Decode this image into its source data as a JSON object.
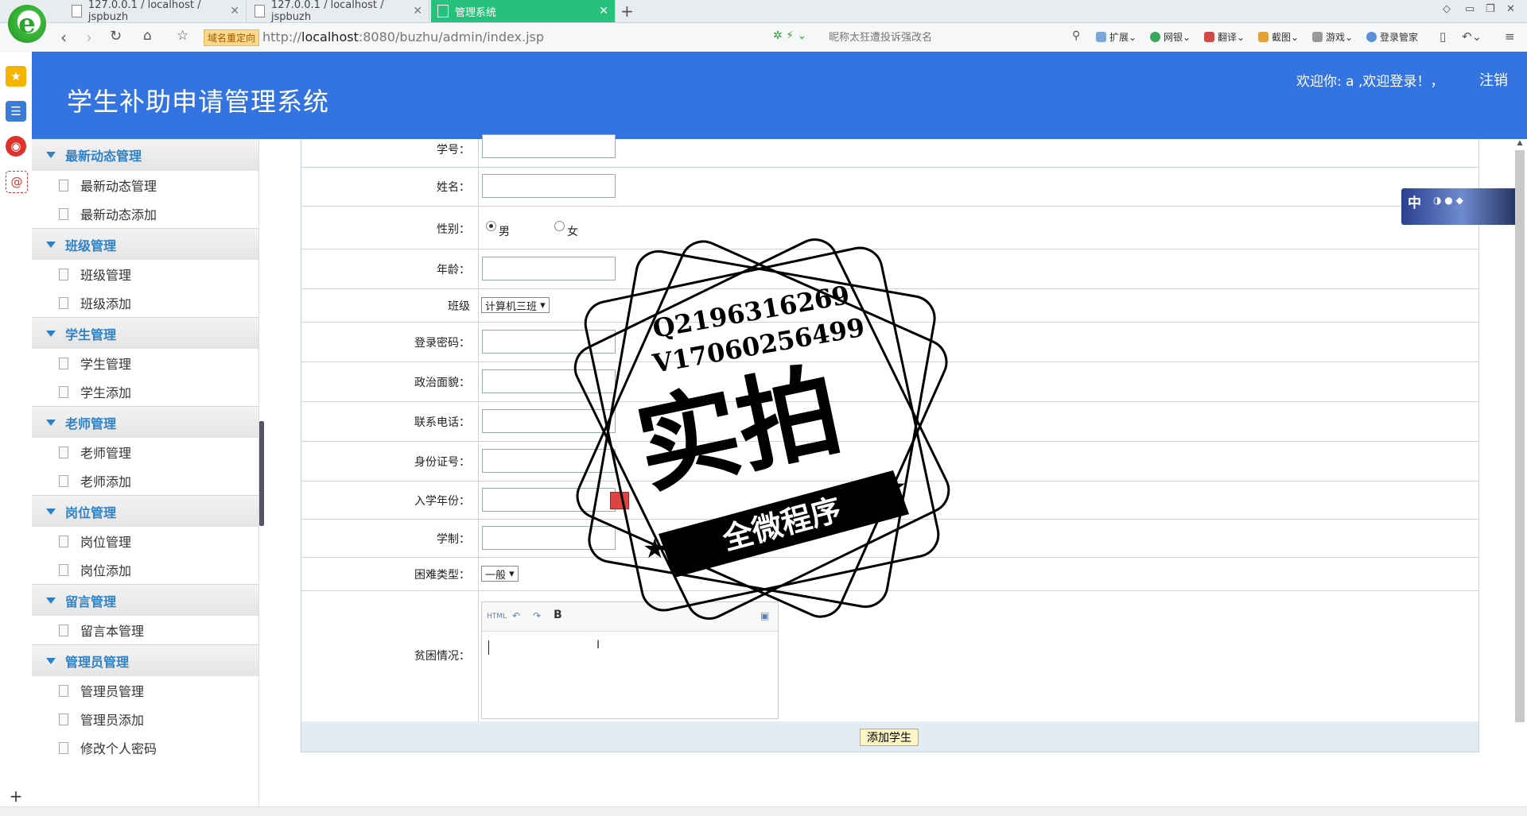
{
  "browser": {
    "tabs": [
      {
        "title": "127.0.0.1 / localhost / jspbuzh",
        "active": false
      },
      {
        "title": "127.0.0.1 / localhost / jspbuzh",
        "active": false
      },
      {
        "title": "管理系统",
        "active": true
      }
    ],
    "redirect_badge": "域名重定向",
    "url_prefix": "http://",
    "url_host": "localhost",
    "url_rest": ":8080/buzhu/admin/index.jsp",
    "search_placeholder": "昵称太狂遭投诉强改名",
    "toolbar": [
      "扩展",
      "网银",
      "翻译",
      "截图",
      "游戏",
      "登录管家"
    ]
  },
  "header": {
    "title": "学生补助申请管理系统",
    "welcome": "欢迎你: a ,欢迎登录！，",
    "logout": "注销"
  },
  "sidebar": {
    "groups": [
      {
        "label": "最新动态管理",
        "items": [
          "最新动态管理",
          "最新动态添加"
        ]
      },
      {
        "label": "班级管理",
        "items": [
          "班级管理",
          "班级添加"
        ]
      },
      {
        "label": "学生管理",
        "items": [
          "学生管理",
          "学生添加"
        ]
      },
      {
        "label": "老师管理",
        "items": [
          "老师管理",
          "老师添加"
        ]
      },
      {
        "label": "岗位管理",
        "items": [
          "岗位管理",
          "岗位添加"
        ]
      },
      {
        "label": "留言管理",
        "items": [
          "留言本管理"
        ]
      },
      {
        "label": "管理员管理",
        "items": [
          "管理员管理",
          "管理员添加",
          "修改个人密码"
        ]
      }
    ]
  },
  "form": {
    "student_id_label": "学号：",
    "name_label": "姓名：",
    "gender_label": "性别：",
    "gender_male": "男",
    "gender_female": "女",
    "age_label": "年龄：",
    "class_label": "班级",
    "class_value": "计算机三班",
    "password_label": "登录密码：",
    "politics_label": "政治面貌：",
    "phone_label": "联系电话：",
    "idcard_label": "身份证号：",
    "enroll_year_label": "入学年份：",
    "duration_label": "学制：",
    "difficulty_label": "困难类型：",
    "difficulty_value": "一般",
    "poverty_label": "贫困情况：",
    "submit": "添加学生"
  },
  "watermark": {
    "line1": "Q2196316269",
    "line2": "V17060256499",
    "big": "实拍",
    "banner": "全微程序"
  },
  "ime": {
    "label": "中"
  },
  "colors": {
    "header_bg": "#3474e0",
    "sidebar_group": "#2f82c8",
    "active_tab": "#26c17a"
  }
}
